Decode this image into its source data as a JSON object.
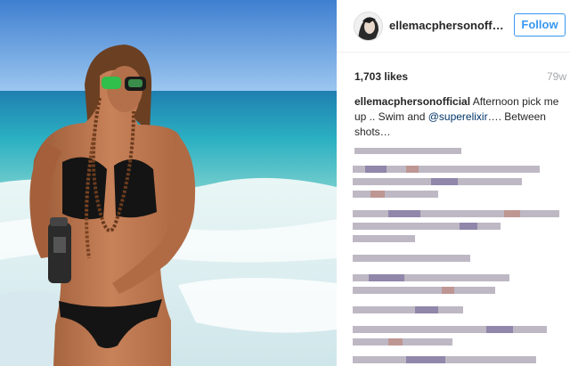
{
  "post": {
    "username": "ellemacphersonofficial",
    "follow_label": "Follow",
    "likes": "1,703 likes",
    "age": "79w",
    "caption_user": "ellemacphersonofficial",
    "caption_text_1": " Afternoon pick me up .. Swim and ",
    "caption_mention": "@superelixir",
    "caption_text_2": "…. Between shots…"
  },
  "colors": {
    "follow_blue": "#3897f0",
    "text": "#262626",
    "muted": "#a5a7aa",
    "mention": "#003569"
  },
  "icons": {
    "avatar": "profile-avatar"
  }
}
